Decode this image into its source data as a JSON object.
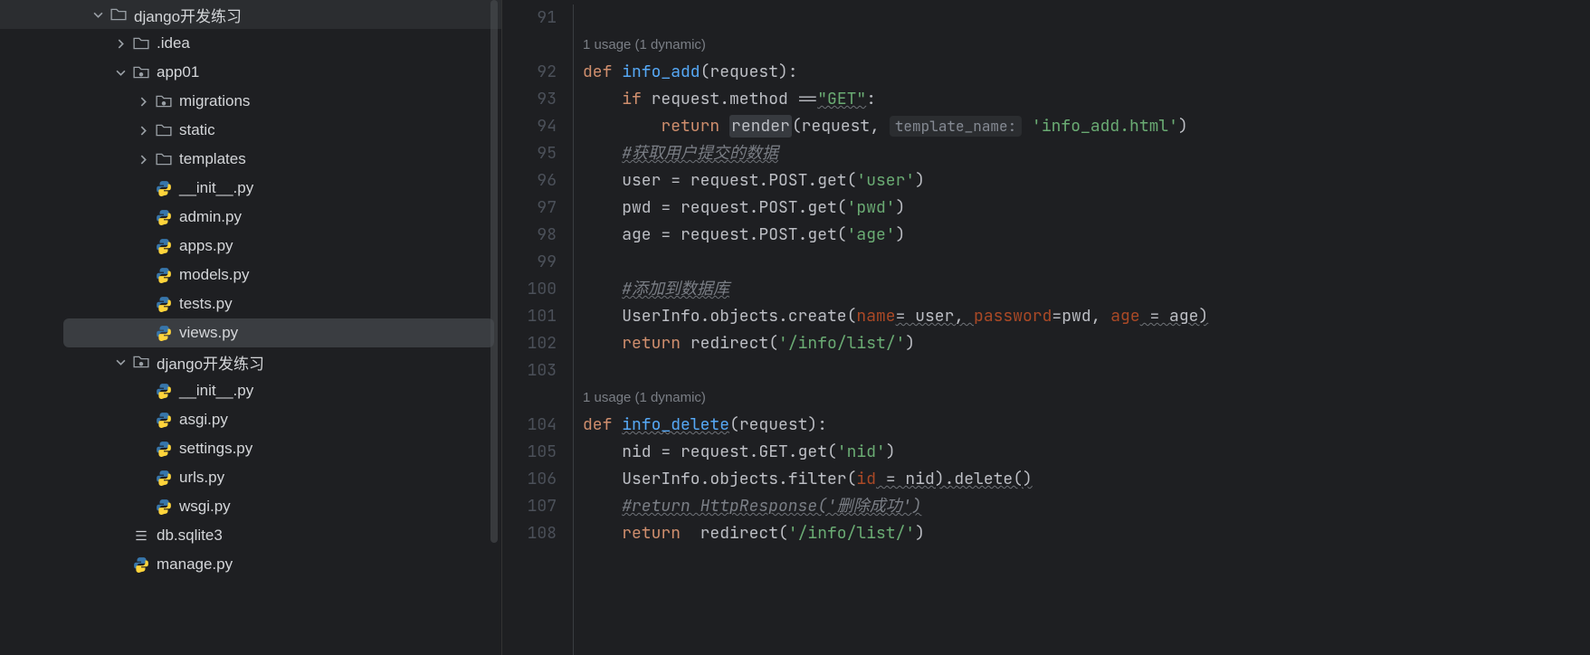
{
  "tree": {
    "root": {
      "label": "django开发练习",
      "expanded": true
    },
    "idea": {
      "label": ".idea"
    },
    "app01": {
      "label": "app01",
      "expanded": true
    },
    "migrations": {
      "label": "migrations"
    },
    "static": {
      "label": "static"
    },
    "templates": {
      "label": "templates"
    },
    "init1": {
      "label": "__init__.py"
    },
    "admin": {
      "label": "admin.py"
    },
    "apps": {
      "label": "apps.py"
    },
    "models": {
      "label": "models.py"
    },
    "tests": {
      "label": "tests.py"
    },
    "views": {
      "label": "views.py"
    },
    "pkg": {
      "label": "django开发练习",
      "expanded": true
    },
    "init2": {
      "label": "__init__.py"
    },
    "asgi": {
      "label": "asgi.py"
    },
    "settings": {
      "label": "settings.py"
    },
    "urls": {
      "label": "urls.py"
    },
    "wsgi": {
      "label": "wsgi.py"
    },
    "db": {
      "label": "db.sqlite3"
    },
    "manage": {
      "label": "manage.py"
    }
  },
  "editor": {
    "usage_hint": "1 usage (1 dynamic)",
    "lines": {
      "l91": "91",
      "l92": "92",
      "l93": "93",
      "l94": "94",
      "l95": "95",
      "l96": "96",
      "l97": "97",
      "l98": "98",
      "l99": "99",
      "l100": "100",
      "l101": "101",
      "l102": "102",
      "l103": "103",
      "l104": "104",
      "l105": "105",
      "l106": "106",
      "l107": "107",
      "l108": "108"
    },
    "code": {
      "def1": "def ",
      "info_add": "info_add",
      "req_p": "(request):",
      "if": "if ",
      "req_method": "request.method ==",
      "get_str": "\"GET\"",
      "colon": ":",
      "return": "return ",
      "render": "render",
      "open_req": "(request, ",
      "tmpl_hint": "template_name:",
      "info_add_html": " 'info_add.html'",
      "close_p": ")",
      "c1": "#获取用户提交的数据",
      "user_eq": "user = request.POST.get(",
      "user_s": "'user'",
      "pwd_eq": "pwd = request.POST.get(",
      "pwd_s": "'pwd'",
      "age_eq": "age = request.POST.get(",
      "age_s": "'age'",
      "c2": "#添加到数据库",
      "create": "UserInfo.objects.create(",
      "name_p": "name",
      "eq_user": "= user, ",
      "password_p": "password",
      "eq_pwd": "=pwd, ",
      "age_p": "age",
      "eq_age": " = age)",
      "redirect": "redirect(",
      "info_list": "'/info/list/'",
      "info_delete": "info_delete",
      "nid_eq": "nid = request.GET.get(",
      "nid_s": "'nid'",
      "filter": "UserInfo.objects.filter(",
      "id_p": "id",
      "eq_nid": " = nid).delete()",
      "c3": "#return HttpResponse('删除成功')",
      "ret_sp": "return  "
    }
  }
}
